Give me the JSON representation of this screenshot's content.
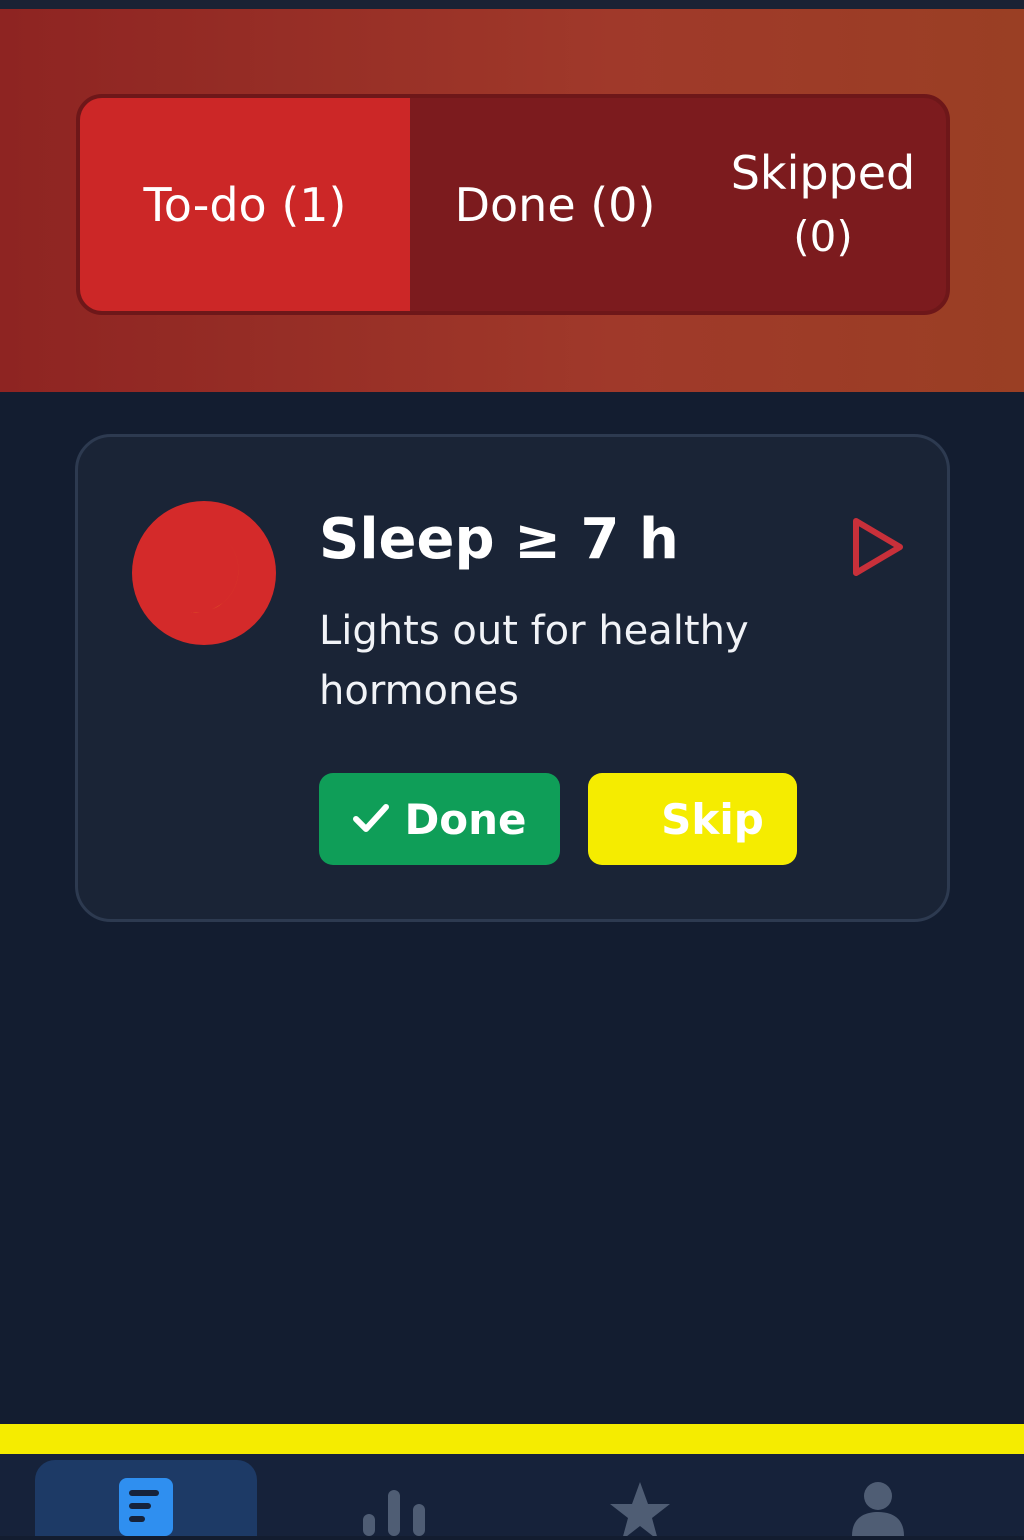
{
  "tabs": [
    {
      "label": "To-do (1)",
      "active": true
    },
    {
      "label": "Done (0)",
      "active": false
    },
    {
      "label": "Skipped",
      "count": "(0)",
      "active": false
    }
  ],
  "task": {
    "title": "Sleep ≥ 7 h",
    "subtitle": "Lights out for healthy hormones",
    "icon": "moon-icon",
    "done_label": "Done",
    "skip_label": "Skip"
  },
  "nav": {
    "items": [
      {
        "icon": "list-icon",
        "active": true
      },
      {
        "icon": "bar-chart-icon",
        "active": false
      },
      {
        "icon": "star-icon",
        "active": false
      },
      {
        "icon": "person-icon",
        "active": false
      }
    ]
  },
  "colors": {
    "header": "#a0392a",
    "active_tab": "#cc2727",
    "done_button": "#0f9e58",
    "skip_button": "#f5ec00",
    "nav_active": "#1d3a66"
  }
}
